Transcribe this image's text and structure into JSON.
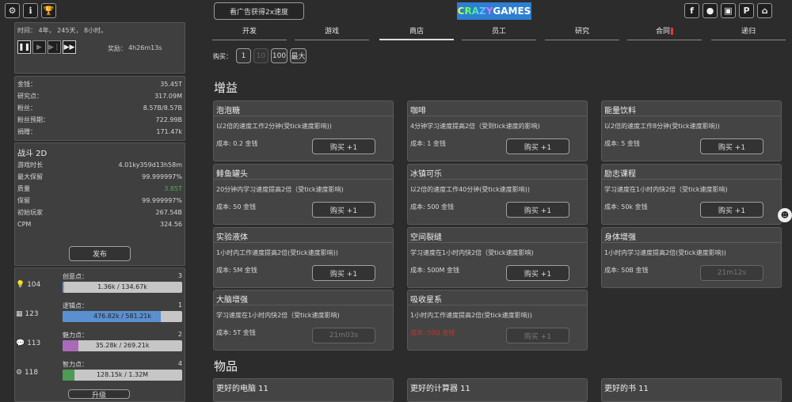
{
  "topbar": {
    "ad_button": "看广告获得2x速度",
    "logo_parts": [
      "CRAZY",
      " GAMES"
    ]
  },
  "time": {
    "line": "时间： 4年， 245天， 8小时。",
    "reward_label": "奖励：",
    "reward_value": "4h26m13s"
  },
  "stats": [
    {
      "k": "金钱：",
      "v": "35.45T"
    },
    {
      "k": "研究点：",
      "v": "317.09M"
    },
    {
      "k": "粉丝：",
      "v": "8.57B/8.57B"
    },
    {
      "k": "粉丝预期：",
      "v": "722.99B"
    },
    {
      "k": "捐赠：",
      "v": "171.47k"
    }
  ],
  "game": {
    "title": "战斗 2D",
    "rows": [
      {
        "k": "游戏时长",
        "v": "4.01ky359d13h58m"
      },
      {
        "k": "最大保留",
        "v": "99.999997%"
      },
      {
        "k": "质量",
        "v": "3.85T"
      },
      {
        "k": "保留",
        "v": "99.999997%"
      },
      {
        "k": "初始玩家",
        "v": "267.54B"
      },
      {
        "k": "CPM",
        "v": "324.56"
      }
    ],
    "publish": "发布"
  },
  "resources": [
    {
      "icon": "💡",
      "count": "104",
      "name": "创意点：",
      "level": "3",
      "bar": "1.36k / 134.67k",
      "ratio": 0.01,
      "color": "#6a9bd8"
    },
    {
      "icon": "▦",
      "count": "123",
      "name": "逻辑点：",
      "level": "1",
      "bar": "476.82k / 581.21k",
      "ratio": 0.82,
      "color": "#5a8fd0"
    },
    {
      "icon": "💬",
      "count": "113",
      "name": "魅力点：",
      "level": "2",
      "bar": "35.28k / 269.21k",
      "ratio": 0.13,
      "color": "#a96bb8"
    },
    {
      "icon": "⚙",
      "count": "118",
      "name": "智力点：",
      "level": "4",
      "bar": "128.15k / 1.32M",
      "ratio": 0.097,
      "color": "#4f9a55"
    }
  ],
  "upgrade_btn": "升级",
  "tabs": [
    "开发",
    "游戏",
    "商店",
    "员工",
    "研究",
    "合同",
    "递归"
  ],
  "buy": {
    "label": "购买：",
    "options": [
      "1",
      "10",
      "100",
      "最大"
    ]
  },
  "sections": {
    "boosts": "增益",
    "items": "物品"
  },
  "cards": [
    {
      "title": "泡泡糖",
      "desc": "以2倍的速度工作2分钟(受tick速度影响))",
      "cost": "成本: 0.2 金钱",
      "btn": "购买 +1"
    },
    {
      "title": "咖啡",
      "desc": "4分钟学习速度提高2倍（受到tick速度的影响)",
      "cost": "成本: 1 金钱",
      "btn": "购买 +1"
    },
    {
      "title": "能量饮料",
      "desc": "以2倍的速度工作8分钟(受tick速度影响))",
      "cost": "成本: 5 金钱",
      "btn": "购买 +1"
    },
    {
      "title": "鲱鱼罐头",
      "desc": "20分钟内学习速度提高2倍（受tick速度影响)",
      "cost": "成本: 50 金钱",
      "btn": "购买 +1"
    },
    {
      "title": "冰镇可乐",
      "desc": "以2倍的速度工作40分钟(受tick速度影响))",
      "cost": "成本: 500 金钱",
      "btn": "购买 +1"
    },
    {
      "title": "励志课程",
      "desc": "学习速度在1小时内快2倍（受tick速度影响)",
      "cost": "成本: 50k 金钱",
      "btn": "购买 +1"
    },
    {
      "title": "实验液体",
      "desc": "1小时内工作速度提高2倍(受tick速度影响))",
      "cost": "成本: 5M 金钱",
      "btn": "购买 +1"
    },
    {
      "title": "空间裂缝",
      "desc": "学习速度在1小时内快2倍（受tick速度影响)",
      "cost": "成本: 500M 金钱",
      "btn": "购买 +1"
    },
    {
      "title": "身体增强",
      "desc": "1小时内学习速度提高2倍(受tick速度影响))",
      "cost": "成本: 50B 金钱",
      "btn": "21m12s"
    },
    {
      "title": "大脑增强",
      "desc": "学习速度在1小时内快2倍（受tick速度影响)",
      "cost": "成本: 5T 金钱",
      "btn": "21m03s"
    },
    {
      "title": "吸收星系",
      "desc": "1小时内工作速度提高2倍(受tick速度影响))",
      "cost": "成本: 50Q 金钱",
      "btn": "购买 +1"
    }
  ],
  "items": [
    "更好的电脑 11",
    "更好的计算器 11",
    "更好的书 11"
  ],
  "colors": {
    "cost_red": "#c0392b",
    "quality_green": "#4caf50",
    "contract_badge": "#e53935"
  }
}
